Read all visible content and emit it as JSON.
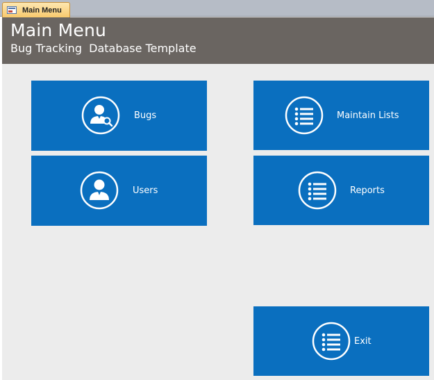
{
  "tab": {
    "label": "Main Menu",
    "icon": "form-icon"
  },
  "header": {
    "title": "Main Menu",
    "subtitle": "Bug Tracking  Database Template"
  },
  "tiles": {
    "bugs": {
      "label": "Bugs",
      "icon": "user-search-icon"
    },
    "users": {
      "label": "Users",
      "icon": "user-icon"
    },
    "maintain_lists": {
      "label": "Maintain Lists",
      "icon": "list-icon"
    },
    "reports": {
      "label": "Reports",
      "icon": "list-icon"
    },
    "exit": {
      "label": "Exit",
      "icon": "list-icon"
    }
  },
  "colors": {
    "tile": "#0a6fbf",
    "header": "#6a6561",
    "background": "#ececec",
    "tab": "#f8c96d"
  }
}
